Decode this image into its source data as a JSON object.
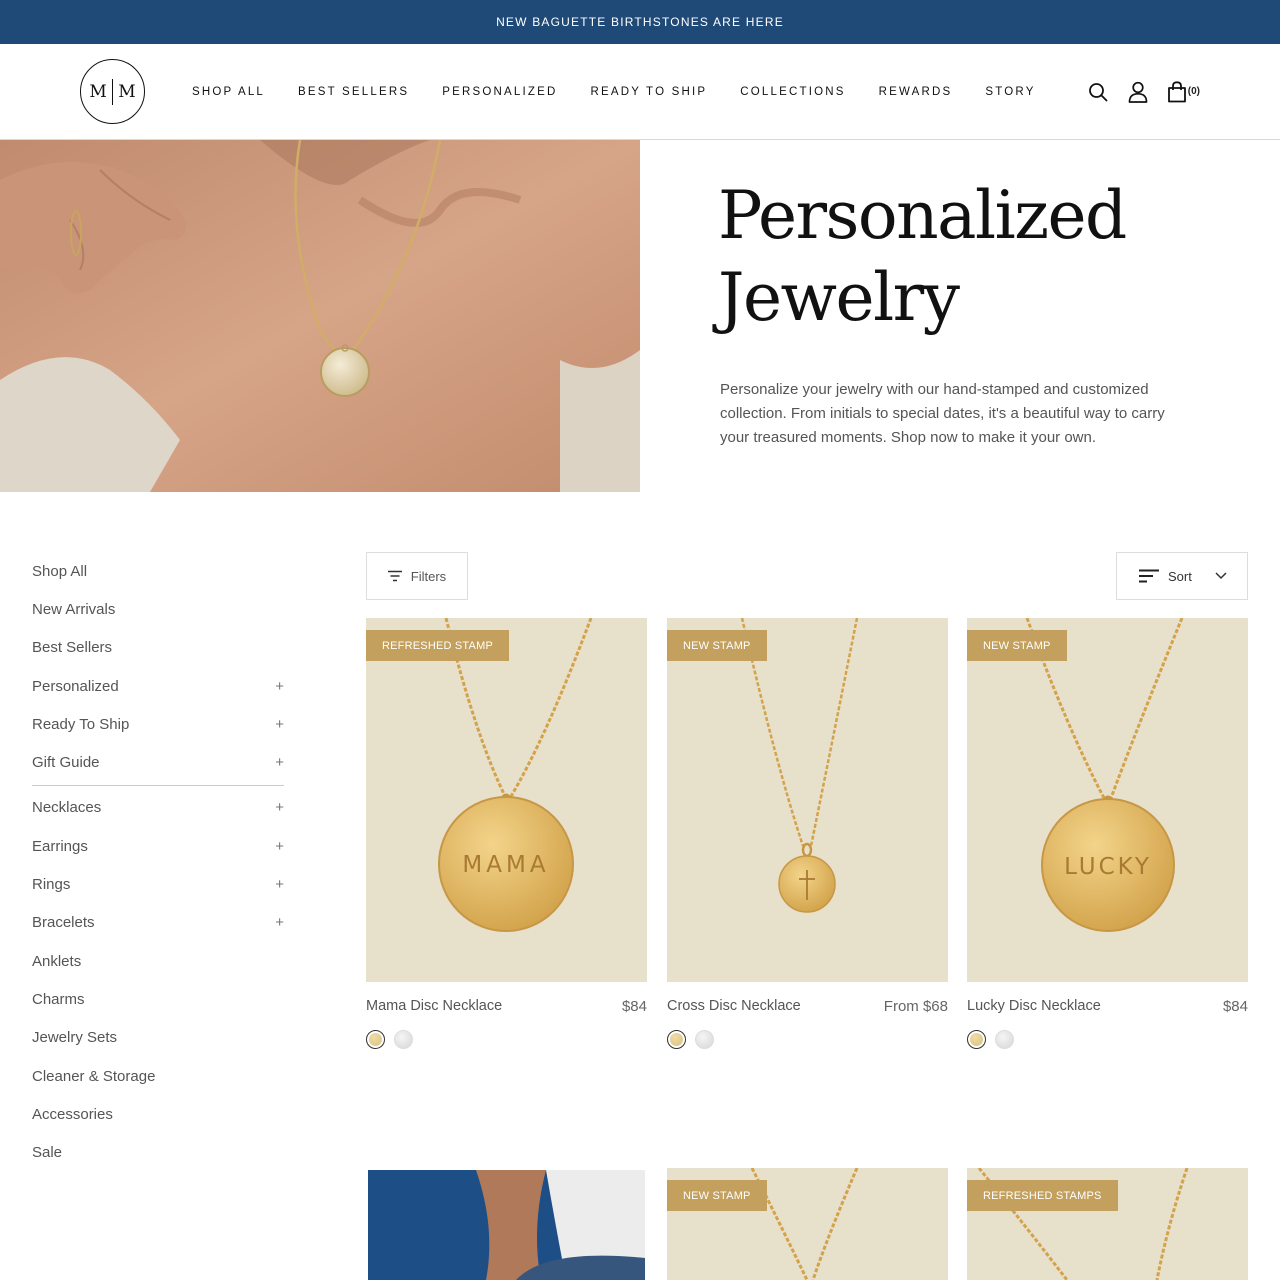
{
  "announcement": "NEW BAGUETTE BIRTHSTONES ARE HERE",
  "logo": {
    "left": "M",
    "right": "M"
  },
  "nav": [
    "SHOP ALL",
    "BEST SELLERS",
    "PERSONALIZED",
    "READY TO SHIP",
    "COLLECTIONS",
    "REWARDS",
    "STORY"
  ],
  "cart_count": "(0)",
  "hero": {
    "title_line1": "Personalized",
    "title_line2": "Jewelry",
    "description": "Personalize your jewelry with our hand-stamped and customized collection. From initials to special dates, it's a beautiful way to carry your treasured moments. Shop now to make it your own."
  },
  "sidebar": {
    "group1": [
      {
        "label": "Shop All",
        "expandable": false
      },
      {
        "label": "New Arrivals",
        "expandable": false
      },
      {
        "label": "Best Sellers",
        "expandable": false
      },
      {
        "label": "Personalized",
        "expandable": true
      },
      {
        "label": "Ready To Ship",
        "expandable": true
      },
      {
        "label": "Gift Guide",
        "expandable": true
      }
    ],
    "group2": [
      {
        "label": "Necklaces",
        "expandable": true
      },
      {
        "label": "Earrings",
        "expandable": true
      },
      {
        "label": "Rings",
        "expandable": true
      },
      {
        "label": "Bracelets",
        "expandable": true
      },
      {
        "label": "Anklets",
        "expandable": false
      },
      {
        "label": "Charms",
        "expandable": false
      },
      {
        "label": "Jewelry Sets",
        "expandable": false
      },
      {
        "label": "Cleaner & Storage",
        "expandable": false
      },
      {
        "label": "Accessories",
        "expandable": false
      },
      {
        "label": "Sale",
        "expandable": false
      }
    ],
    "plus_symbol": "+"
  },
  "toolbar": {
    "filters_label": "Filters",
    "sort_label": "Sort"
  },
  "products": [
    {
      "name": "Mama Disc Necklace",
      "price": "$84",
      "badge": "REFRESHED STAMP",
      "stamp": "MAMA",
      "swatches": [
        "gold",
        "silver"
      ]
    },
    {
      "name": "Cross Disc Necklace",
      "price": "From $68",
      "badge": "NEW STAMP",
      "stamp": "",
      "swatches": [
        "gold",
        "silver"
      ]
    },
    {
      "name": "Lucky Disc Necklace",
      "price": "$84",
      "badge": "NEW STAMP",
      "stamp": "LUCKY",
      "swatches": [
        "gold",
        "silver"
      ]
    }
  ],
  "products_row2": [
    {
      "badge": ""
    },
    {
      "badge": "NEW STAMP"
    },
    {
      "badge": "REFRESHED STAMPS"
    }
  ],
  "colors": {
    "announcement_bg": "#1f4a77",
    "badge_bg": "#c3a05d",
    "product_bg": "#e7e0cb"
  }
}
